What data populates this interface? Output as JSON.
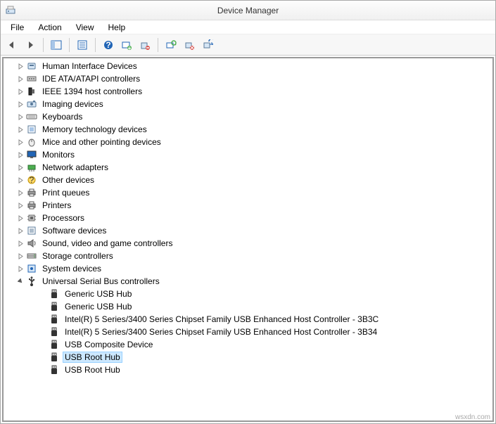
{
  "window": {
    "title": "Device Manager"
  },
  "menu": {
    "file": "File",
    "action": "Action",
    "view": "View",
    "help": "Help"
  },
  "toolbar": {
    "back": "Back",
    "forward": "Forward",
    "show_hide": "Show/Hide Console Tree",
    "properties": "Properties",
    "help": "Help",
    "update": "Update Driver Software",
    "uninstall": "Uninstall",
    "scan": "Scan for hardware changes",
    "disable": "Disable",
    "add": "Add legacy hardware"
  },
  "tree": {
    "categories": [
      {
        "label": "Human Interface Devices",
        "icon": "hid"
      },
      {
        "label": "IDE ATA/ATAPI controllers",
        "icon": "ide"
      },
      {
        "label": "IEEE 1394 host controllers",
        "icon": "ieee"
      },
      {
        "label": "Imaging devices",
        "icon": "imaging"
      },
      {
        "label": "Keyboards",
        "icon": "keyboard"
      },
      {
        "label": "Memory technology devices",
        "icon": "memory"
      },
      {
        "label": "Mice and other pointing devices",
        "icon": "mouse"
      },
      {
        "label": "Monitors",
        "icon": "monitor"
      },
      {
        "label": "Network adapters",
        "icon": "network"
      },
      {
        "label": "Other devices",
        "icon": "other"
      },
      {
        "label": "Print queues",
        "icon": "printer"
      },
      {
        "label": "Printers",
        "icon": "printer"
      },
      {
        "label": "Processors",
        "icon": "cpu"
      },
      {
        "label": "Software devices",
        "icon": "software"
      },
      {
        "label": "Sound, video and game controllers",
        "icon": "sound"
      },
      {
        "label": "Storage controllers",
        "icon": "storage"
      },
      {
        "label": "System devices",
        "icon": "system"
      }
    ],
    "usb_category": {
      "label": "Universal Serial Bus controllers",
      "icon": "usb",
      "expanded": true,
      "children": [
        {
          "label": "Generic USB Hub"
        },
        {
          "label": "Generic USB Hub"
        },
        {
          "label": "Intel(R) 5 Series/3400 Series Chipset Family USB Enhanced Host Controller - 3B3C"
        },
        {
          "label": "Intel(R) 5 Series/3400 Series Chipset Family USB Enhanced Host Controller - 3B34"
        },
        {
          "label": "USB Composite Device"
        },
        {
          "label": "USB Root Hub",
          "selected": true
        },
        {
          "label": "USB Root Hub"
        }
      ]
    }
  },
  "watermark": "wsxdn.com"
}
